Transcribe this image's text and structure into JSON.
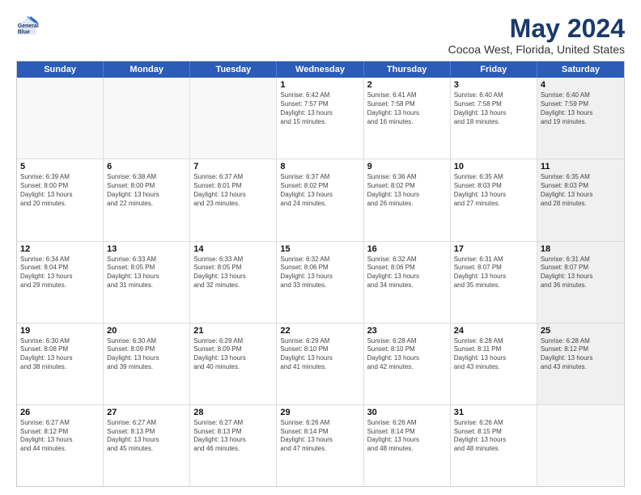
{
  "logo": {
    "line1": "General",
    "line2": "Blue"
  },
  "title": "May 2024",
  "subtitle": "Cocoa West, Florida, United States",
  "header": {
    "days": [
      "Sunday",
      "Monday",
      "Tuesday",
      "Wednesday",
      "Thursday",
      "Friday",
      "Saturday"
    ]
  },
  "rows": [
    {
      "cells": [
        {
          "day": "",
          "empty": true
        },
        {
          "day": "",
          "empty": true
        },
        {
          "day": "",
          "empty": true
        },
        {
          "day": "1",
          "line1": "Sunrise: 6:42 AM",
          "line2": "Sunset: 7:57 PM",
          "line3": "Daylight: 13 hours",
          "line4": "and 15 minutes."
        },
        {
          "day": "2",
          "line1": "Sunrise: 6:41 AM",
          "line2": "Sunset: 7:58 PM",
          "line3": "Daylight: 13 hours",
          "line4": "and 16 minutes."
        },
        {
          "day": "3",
          "line1": "Sunrise: 6:40 AM",
          "line2": "Sunset: 7:58 PM",
          "line3": "Daylight: 13 hours",
          "line4": "and 18 minutes."
        },
        {
          "day": "4",
          "line1": "Sunrise: 6:40 AM",
          "line2": "Sunset: 7:59 PM",
          "line3": "Daylight: 13 hours",
          "line4": "and 19 minutes.",
          "shaded": true
        }
      ]
    },
    {
      "cells": [
        {
          "day": "5",
          "line1": "Sunrise: 6:39 AM",
          "line2": "Sunset: 8:00 PM",
          "line3": "Daylight: 13 hours",
          "line4": "and 20 minutes."
        },
        {
          "day": "6",
          "line1": "Sunrise: 6:38 AM",
          "line2": "Sunset: 8:00 PM",
          "line3": "Daylight: 13 hours",
          "line4": "and 22 minutes."
        },
        {
          "day": "7",
          "line1": "Sunrise: 6:37 AM",
          "line2": "Sunset: 8:01 PM",
          "line3": "Daylight: 13 hours",
          "line4": "and 23 minutes."
        },
        {
          "day": "8",
          "line1": "Sunrise: 6:37 AM",
          "line2": "Sunset: 8:02 PM",
          "line3": "Daylight: 13 hours",
          "line4": "and 24 minutes."
        },
        {
          "day": "9",
          "line1": "Sunrise: 6:36 AM",
          "line2": "Sunset: 8:02 PM",
          "line3": "Daylight: 13 hours",
          "line4": "and 26 minutes."
        },
        {
          "day": "10",
          "line1": "Sunrise: 6:35 AM",
          "line2": "Sunset: 8:03 PM",
          "line3": "Daylight: 13 hours",
          "line4": "and 27 minutes."
        },
        {
          "day": "11",
          "line1": "Sunrise: 6:35 AM",
          "line2": "Sunset: 8:03 PM",
          "line3": "Daylight: 13 hours",
          "line4": "and 28 minutes.",
          "shaded": true
        }
      ]
    },
    {
      "cells": [
        {
          "day": "12",
          "line1": "Sunrise: 6:34 AM",
          "line2": "Sunset: 8:04 PM",
          "line3": "Daylight: 13 hours",
          "line4": "and 29 minutes."
        },
        {
          "day": "13",
          "line1": "Sunrise: 6:33 AM",
          "line2": "Sunset: 8:05 PM",
          "line3": "Daylight: 13 hours",
          "line4": "and 31 minutes."
        },
        {
          "day": "14",
          "line1": "Sunrise: 6:33 AM",
          "line2": "Sunset: 8:05 PM",
          "line3": "Daylight: 13 hours",
          "line4": "and 32 minutes."
        },
        {
          "day": "15",
          "line1": "Sunrise: 6:32 AM",
          "line2": "Sunset: 8:06 PM",
          "line3": "Daylight: 13 hours",
          "line4": "and 33 minutes."
        },
        {
          "day": "16",
          "line1": "Sunrise: 6:32 AM",
          "line2": "Sunset: 8:06 PM",
          "line3": "Daylight: 13 hours",
          "line4": "and 34 minutes."
        },
        {
          "day": "17",
          "line1": "Sunrise: 6:31 AM",
          "line2": "Sunset: 8:07 PM",
          "line3": "Daylight: 13 hours",
          "line4": "and 35 minutes."
        },
        {
          "day": "18",
          "line1": "Sunrise: 6:31 AM",
          "line2": "Sunset: 8:07 PM",
          "line3": "Daylight: 13 hours",
          "line4": "and 36 minutes.",
          "shaded": true
        }
      ]
    },
    {
      "cells": [
        {
          "day": "19",
          "line1": "Sunrise: 6:30 AM",
          "line2": "Sunset: 8:08 PM",
          "line3": "Daylight: 13 hours",
          "line4": "and 38 minutes."
        },
        {
          "day": "20",
          "line1": "Sunrise: 6:30 AM",
          "line2": "Sunset: 8:09 PM",
          "line3": "Daylight: 13 hours",
          "line4": "and 39 minutes."
        },
        {
          "day": "21",
          "line1": "Sunrise: 6:29 AM",
          "line2": "Sunset: 8:09 PM",
          "line3": "Daylight: 13 hours",
          "line4": "and 40 minutes."
        },
        {
          "day": "22",
          "line1": "Sunrise: 6:29 AM",
          "line2": "Sunset: 8:10 PM",
          "line3": "Daylight: 13 hours",
          "line4": "and 41 minutes."
        },
        {
          "day": "23",
          "line1": "Sunrise: 6:28 AM",
          "line2": "Sunset: 8:10 PM",
          "line3": "Daylight: 13 hours",
          "line4": "and 42 minutes."
        },
        {
          "day": "24",
          "line1": "Sunrise: 6:28 AM",
          "line2": "Sunset: 8:11 PM",
          "line3": "Daylight: 13 hours",
          "line4": "and 43 minutes."
        },
        {
          "day": "25",
          "line1": "Sunrise: 6:28 AM",
          "line2": "Sunset: 8:12 PM",
          "line3": "Daylight: 13 hours",
          "line4": "and 43 minutes.",
          "shaded": true
        }
      ]
    },
    {
      "cells": [
        {
          "day": "26",
          "line1": "Sunrise: 6:27 AM",
          "line2": "Sunset: 8:12 PM",
          "line3": "Daylight: 13 hours",
          "line4": "and 44 minutes."
        },
        {
          "day": "27",
          "line1": "Sunrise: 6:27 AM",
          "line2": "Sunset: 8:13 PM",
          "line3": "Daylight: 13 hours",
          "line4": "and 45 minutes."
        },
        {
          "day": "28",
          "line1": "Sunrise: 6:27 AM",
          "line2": "Sunset: 8:13 PM",
          "line3": "Daylight: 13 hours",
          "line4": "and 46 minutes."
        },
        {
          "day": "29",
          "line1": "Sunrise: 6:26 AM",
          "line2": "Sunset: 8:14 PM",
          "line3": "Daylight: 13 hours",
          "line4": "and 47 minutes."
        },
        {
          "day": "30",
          "line1": "Sunrise: 6:26 AM",
          "line2": "Sunset: 8:14 PM",
          "line3": "Daylight: 13 hours",
          "line4": "and 48 minutes."
        },
        {
          "day": "31",
          "line1": "Sunrise: 6:26 AM",
          "line2": "Sunset: 8:15 PM",
          "line3": "Daylight: 13 hours",
          "line4": "and 48 minutes."
        },
        {
          "day": "",
          "empty": true,
          "shaded": true
        }
      ]
    }
  ]
}
